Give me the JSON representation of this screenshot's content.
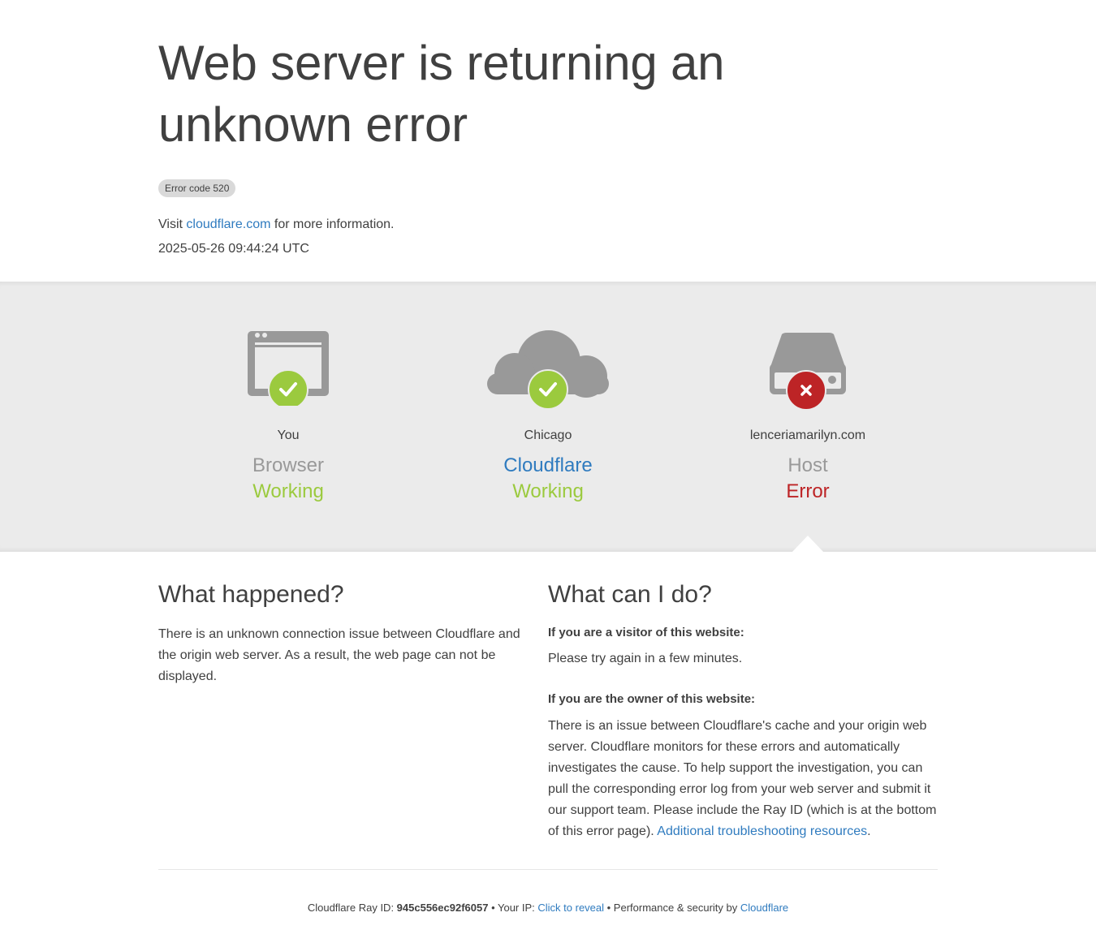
{
  "header": {
    "title": "Web server is returning an unknown error",
    "error_code": "Error code 520",
    "visit_prefix": "Visit ",
    "visit_link": "cloudflare.com",
    "visit_suffix": " for more information.",
    "timestamp": "2025-05-26 09:44:24 UTC"
  },
  "nodes": [
    {
      "location": "You",
      "type": "Browser",
      "status": "Working",
      "icon": "browser-icon",
      "state": "ok"
    },
    {
      "location": "Chicago",
      "type": "Cloudflare",
      "status": "Working",
      "icon": "cloud-icon",
      "state": "ok"
    },
    {
      "location": "lenceriamarilyn.com",
      "type": "Host",
      "status": "Error",
      "icon": "server-icon",
      "state": "error"
    }
  ],
  "colors": {
    "ok": "#9bca3e",
    "error": "#bd2426",
    "link": "#2f7bbf",
    "icon_gray": "#999999",
    "band": "#ebebeb"
  },
  "what_happened": {
    "heading": "What happened?",
    "body": "There is an unknown connection issue between Cloudflare and the origin web server. As a result, the web page can not be displayed."
  },
  "what_can_i_do": {
    "heading": "What can I do?",
    "visitor_heading": "If you are a visitor of this website:",
    "visitor_body": "Please try again in a few minutes.",
    "owner_heading": "If you are the owner of this website:",
    "owner_body": "There is an issue between Cloudflare's cache and your origin web server. Cloudflare monitors for these errors and automatically investigates the cause. To help support the investigation, you can pull the corresponding error log from your web server and submit it our support team. Please include the Ray ID (which is at the bottom of this error page).",
    "owner_link": "Additional troubleshooting resources",
    "owner_link_suffix": "."
  },
  "footer": {
    "ray_label": "Cloudflare Ray ID: ",
    "ray_id": "945c556ec92f6057",
    "sep1": " • Your IP: ",
    "reveal_link": "Click to reveal",
    "sep2": " • Performance & security by ",
    "cf_link": "Cloudflare"
  }
}
